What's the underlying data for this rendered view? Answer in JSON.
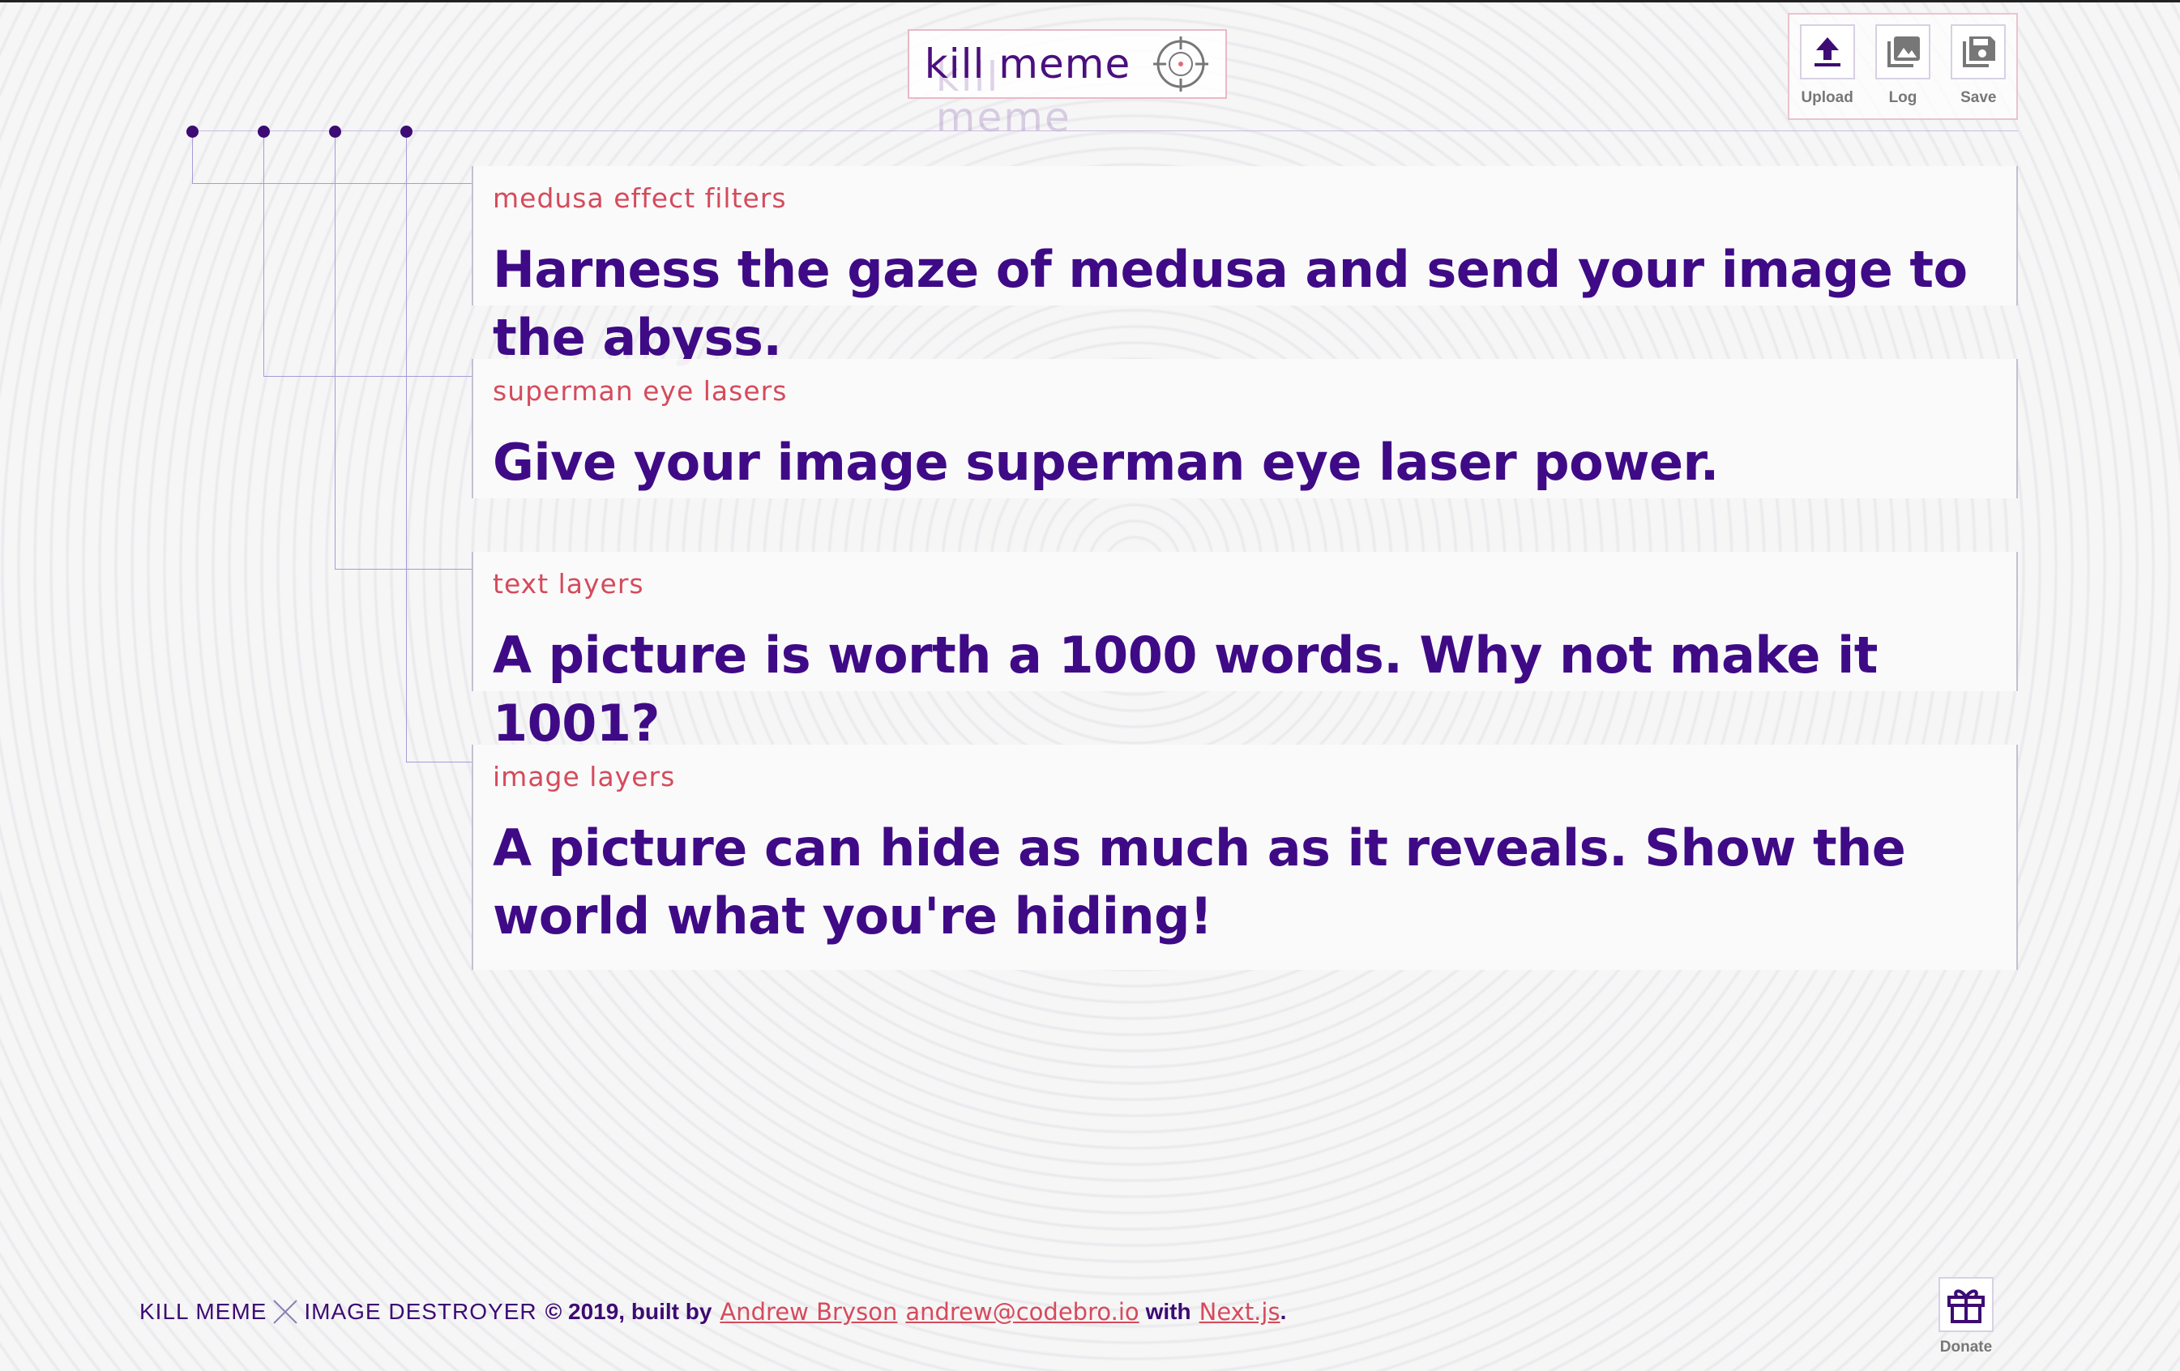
{
  "app": {
    "title": "kill meme"
  },
  "toolbar": {
    "items": [
      {
        "label": "Upload",
        "icon": "upload-icon"
      },
      {
        "label": "Log",
        "icon": "gallery-icon"
      },
      {
        "label": "Save",
        "icon": "save-icon"
      }
    ]
  },
  "features": [
    {
      "tag": "medusa effect filters",
      "description": "Harness the gaze of medusa and send your image to the abyss."
    },
    {
      "tag": "superman eye lasers",
      "description": "Give your image superman eye laser power."
    },
    {
      "tag": "text layers",
      "description": "A picture is worth a 1000 words. Why not make it 1001?"
    },
    {
      "tag": "image layers",
      "description": "A picture can hide as much as it reveals. Show the world what you're hiding!"
    }
  ],
  "footer": {
    "brand_left": "KILL MEME",
    "brand_right": "IMAGE DESTROYER",
    "copyright": "© 2019, built by",
    "author": "Andrew Bryson",
    "email": "andrew@codebro.io",
    "with_text": "with",
    "framework": "Next.js",
    "period": "."
  },
  "donate": {
    "label": "Donate",
    "icon": "gift-icon"
  },
  "colors": {
    "accent_purple": "#3f0a86",
    "accent_red": "#d54b5b",
    "icon_gray": "#777777"
  }
}
